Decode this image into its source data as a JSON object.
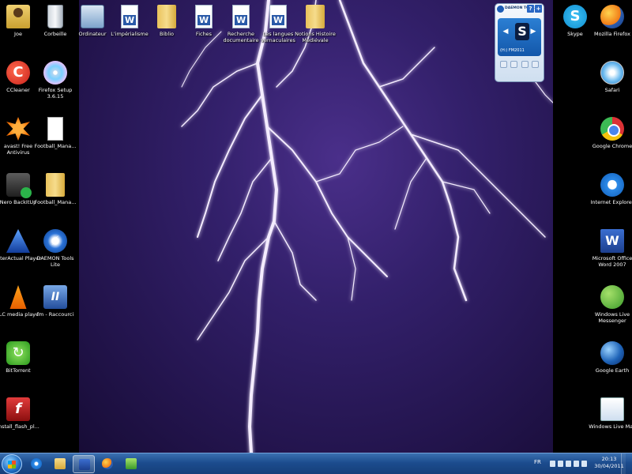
{
  "desktop": {
    "icons": [
      {
        "label": "Joe",
        "glyph": "g-user",
        "name": "icon-joe"
      },
      {
        "label": "Corbeille",
        "glyph": "g-bin",
        "name": "icon-recycle-bin"
      },
      {
        "label": "Ordinateur",
        "glyph": "g-comp",
        "name": "icon-computer"
      },
      {
        "label": "L'impérialisme",
        "glyph": "g-doc",
        "name": "icon-doc-imperialisme"
      },
      {
        "label": "Biblio",
        "glyph": "g-folder",
        "name": "icon-folder-biblio"
      },
      {
        "label": "Fiches",
        "glyph": "g-doc",
        "name": "icon-doc-fiches"
      },
      {
        "label": "Recherche documentaire",
        "glyph": "g-doc",
        "name": "icon-doc-recherche"
      },
      {
        "label": "Les langues vernaculaires",
        "glyph": "g-doc",
        "name": "icon-doc-langues"
      },
      {
        "label": "Notions Histoire Médiévale",
        "glyph": "g-folder",
        "name": "icon-folder-notions"
      },
      {
        "label": "CCleaner",
        "glyph": "g-ccleaner",
        "name": "icon-ccleaner"
      },
      {
        "label": "Firefox Setup 3.6.15",
        "glyph": "g-cd",
        "name": "icon-firefox-setup"
      },
      {
        "label": "avast! Free Antivirus",
        "glyph": "g-avast",
        "name": "icon-avast"
      },
      {
        "label": "Football_Mana...",
        "glyph": "g-paper",
        "name": "icon-football-manager-1"
      },
      {
        "label": "Nero BackItUp",
        "glyph": "g-nero",
        "name": "icon-nero-backitup"
      },
      {
        "label": "Football_Mana...",
        "glyph": "g-folder",
        "name": "icon-football-manager-2"
      },
      {
        "label": "InterActual Player",
        "glyph": "g-interactual",
        "name": "icon-interactual-player"
      },
      {
        "label": "DAEMON Tools Lite",
        "glyph": "g-daemon",
        "name": "icon-daemon-tools"
      },
      {
        "label": "VLC media player",
        "glyph": "g-vlc",
        "name": "icon-vlc"
      },
      {
        "label": "fm - Raccourci",
        "glyph": "g-fm",
        "name": "icon-fm-shortcut"
      },
      {
        "label": "BitTorrent",
        "glyph": "g-bittorrent",
        "name": "icon-bittorrent"
      },
      {
        "label": "install_flash_pl...",
        "glyph": "g-flash",
        "name": "icon-install-flash"
      },
      {
        "label": "Skype",
        "glyph": "g-skype",
        "name": "icon-skype"
      },
      {
        "label": "Mozilla Firefox",
        "glyph": "g-firefox",
        "name": "icon-mozilla-firefox"
      },
      {
        "label": "Safari",
        "glyph": "g-safari",
        "name": "icon-safari"
      },
      {
        "label": "Google Chrome",
        "glyph": "g-chrome",
        "name": "icon-google-chrome"
      },
      {
        "label": "Internet Explorer",
        "glyph": "g-ie",
        "name": "icon-internet-explorer"
      },
      {
        "label": "Microsoft Office Word 2007",
        "glyph": "g-word",
        "name": "icon-word-2007"
      },
      {
        "label": "Windows Live Messenger",
        "glyph": "g-messenger",
        "name": "icon-live-messenger"
      },
      {
        "label": "Google Earth",
        "glyph": "g-gearth",
        "name": "icon-google-earth"
      },
      {
        "label": "Windows Live Mail",
        "glyph": "g-mail",
        "name": "icon-live-mail"
      }
    ]
  },
  "gadget": {
    "title": "DAEMON TOOLS",
    "help": "?",
    "options": "+",
    "disc_glyph": "S",
    "drive": "(H:) FM2011",
    "prev": "◀",
    "next": "▶"
  },
  "taskbar": {
    "apps": [
      {
        "name": "taskbar-ie",
        "cls": "tb-ie",
        "active": false
      },
      {
        "name": "taskbar-explorer",
        "cls": "tb-explorer",
        "active": false
      },
      {
        "name": "taskbar-word",
        "cls": "tb-word",
        "active": true
      },
      {
        "name": "taskbar-firefox",
        "cls": "tb-firefox",
        "active": false
      },
      {
        "name": "taskbar-fm",
        "cls": "tb-fm",
        "active": false
      }
    ],
    "language": "FR",
    "time": "20:13",
    "date": "30/04/2011"
  }
}
